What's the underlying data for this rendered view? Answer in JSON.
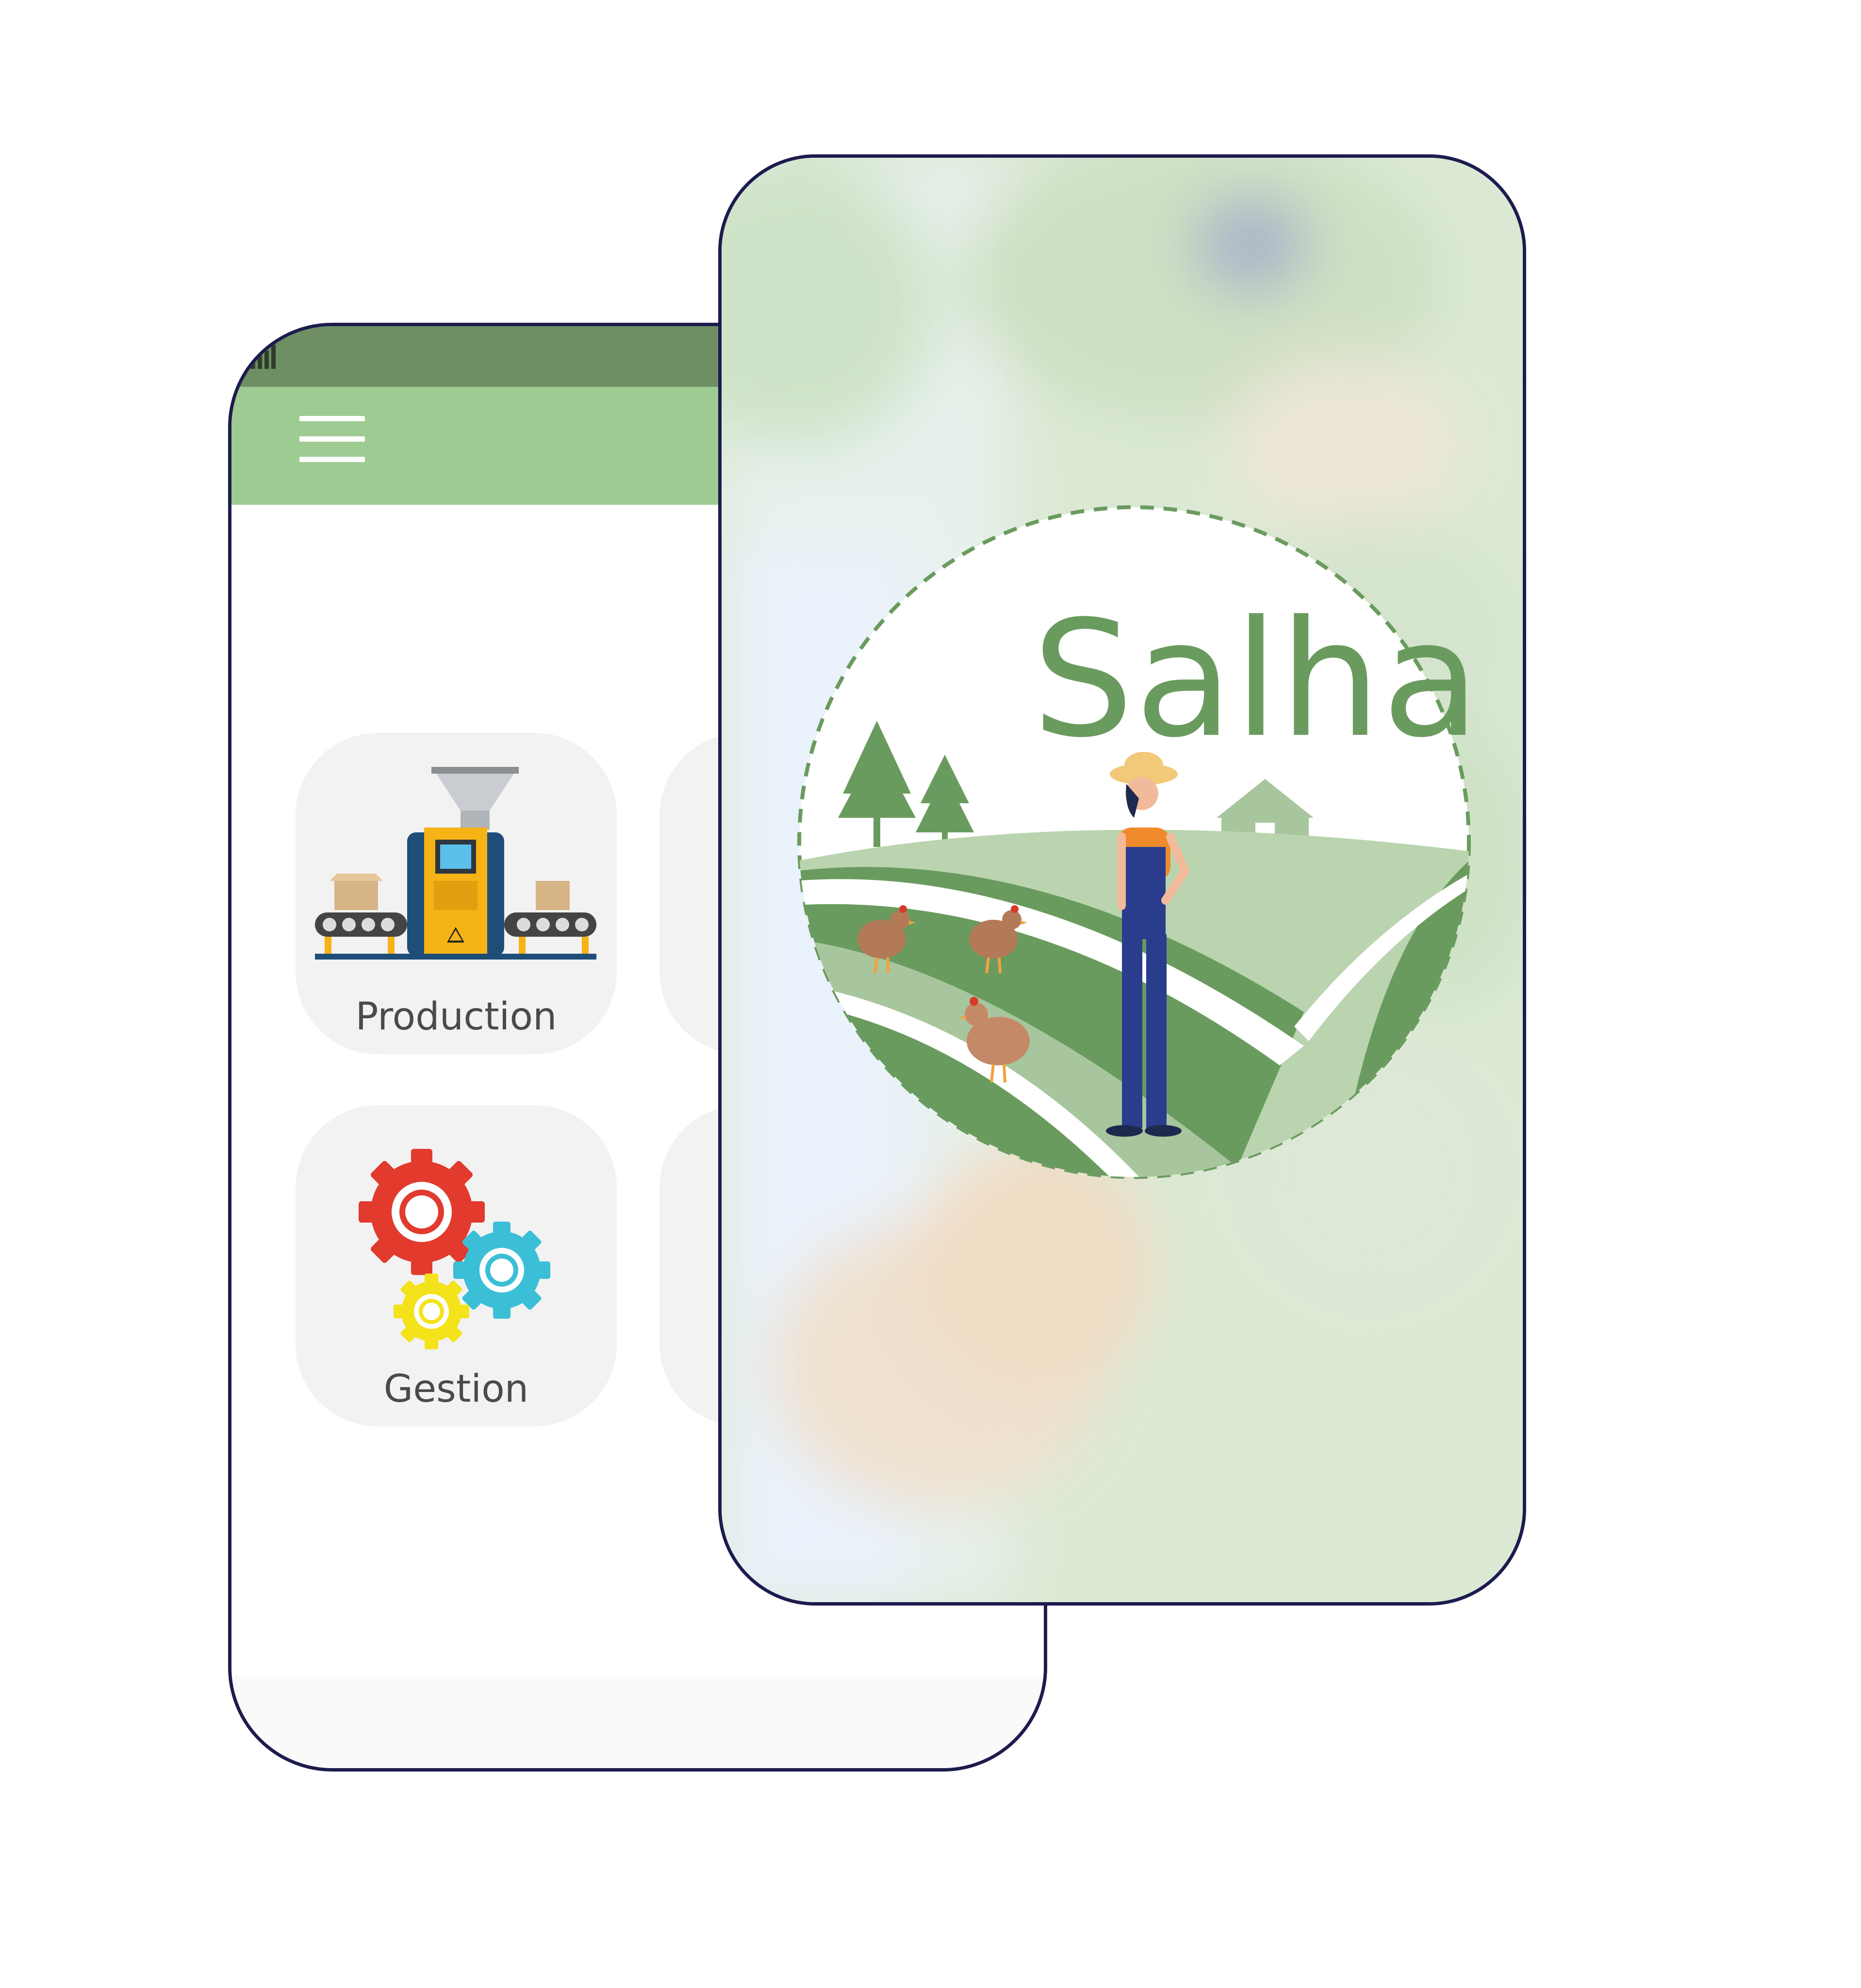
{
  "menu": {
    "icon": "hamburger-menu-icon"
  },
  "tiles": [
    {
      "label": "Production",
      "icon": "production-line-icon"
    },
    {
      "label": "Gestion",
      "icon": "gears-icon"
    }
  ],
  "splash": {
    "brand": "Salha",
    "logo_icon": "farm-logo-icon"
  },
  "colors": {
    "status_bar": "#6e8f63",
    "app_bar": "#9ecb91",
    "brand_green": "#6a9b5e",
    "frame": "#1d1b4e",
    "tile_bg": "#f2f2f2"
  }
}
